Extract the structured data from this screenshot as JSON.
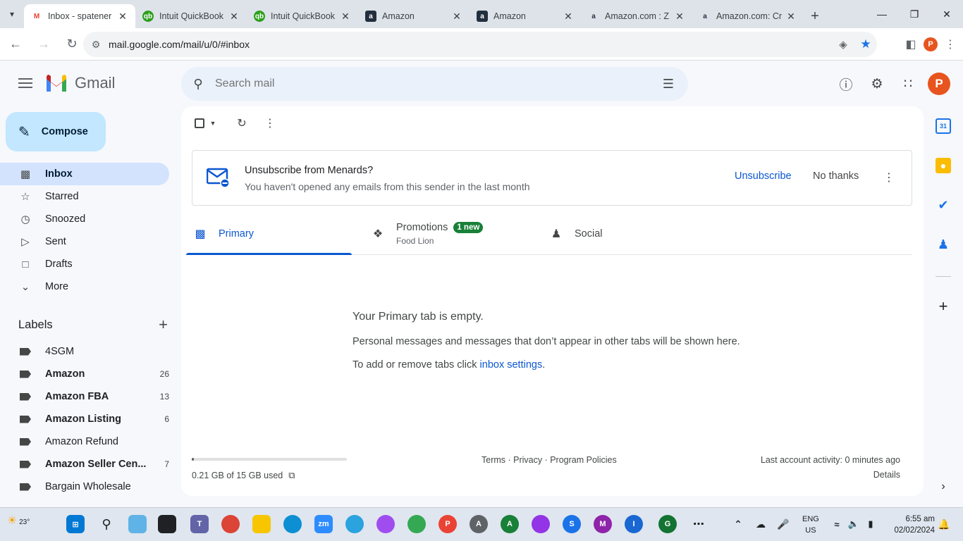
{
  "browser": {
    "tabs": [
      {
        "title": "Inbox - spatener",
        "favicon": "gmail-icon",
        "active": true
      },
      {
        "title": "Intuit QuickBook",
        "favicon": "quickbooks-icon",
        "active": false
      },
      {
        "title": "Intuit QuickBook",
        "favicon": "quickbooks-icon",
        "active": false
      },
      {
        "title": "Amazon",
        "favicon": "amazon-icon",
        "active": false
      },
      {
        "title": "Amazon",
        "favicon": "amazon-icon",
        "active": false
      },
      {
        "title": "Amazon.com : Z",
        "favicon": "amazon-icon",
        "active": false
      },
      {
        "title": "Amazon.com: Cr",
        "favicon": "amazon-icon",
        "active": false
      }
    ],
    "url": "mail.google.com/mail/u/0/#inbox",
    "profile_initial": "P"
  },
  "gmail": {
    "logo_text": "Gmail",
    "search_placeholder": "Search mail",
    "avatar_initial": "P",
    "compose_label": "Compose",
    "nav": [
      {
        "label": "Inbox",
        "icon": "inbox-icon",
        "active": true
      },
      {
        "label": "Starred",
        "icon": "star-icon",
        "active": false
      },
      {
        "label": "Snoozed",
        "icon": "clock-icon",
        "active": false
      },
      {
        "label": "Sent",
        "icon": "send-icon",
        "active": false
      },
      {
        "label": "Drafts",
        "icon": "draft-icon",
        "active": false
      },
      {
        "label": "More",
        "icon": "chevron-down-icon",
        "active": false
      }
    ],
    "labels_title": "Labels",
    "labels": [
      {
        "name": "4SGM",
        "count": "",
        "bold": false
      },
      {
        "name": "Amazon",
        "count": "26",
        "bold": true
      },
      {
        "name": "Amazon FBA",
        "count": "13",
        "bold": true
      },
      {
        "name": "Amazon Listing",
        "count": "6",
        "bold": true
      },
      {
        "name": "Amazon Refund",
        "count": "",
        "bold": false
      },
      {
        "name": "Amazon Seller Cen...",
        "count": "7",
        "bold": true
      },
      {
        "name": "Bargain Wholesale",
        "count": "",
        "bold": false
      }
    ],
    "unsubscribe": {
      "title": "Unsubscribe from Menards?",
      "subtitle": "You haven't opened any emails from this sender in the last month",
      "unsubscribe_label": "Unsubscribe",
      "no_thanks_label": "No thanks"
    },
    "tabs": {
      "primary": "Primary",
      "promotions": "Promotions",
      "promotions_badge": "1 new",
      "promotions_sub": "Food Lion",
      "social": "Social"
    },
    "empty": {
      "title": "Your Primary tab is empty.",
      "description": "Personal messages and messages that don’t appear in other tabs will be shown here.",
      "line3_prefix": "To add or remove tabs click ",
      "line3_link": "inbox settings",
      "line3_suffix": "."
    },
    "footer": {
      "storage": "0.21 GB of 15 GB used",
      "storage_fraction": 0.014,
      "links": "Terms · Privacy · Program Policies",
      "activity": "Last account activity: 0 minutes ago",
      "details": "Details"
    }
  },
  "taskbar": {
    "weather": "23°",
    "lang_top": "ENG",
    "lang_bottom": "US",
    "time": "6:55 am",
    "date": "02/02/2024"
  },
  "colors": {
    "accent": "#0b57d0",
    "compose_bg": "#c2e7ff",
    "active_nav_bg": "#d3e3fd",
    "badge_green": "#188038",
    "avatar": "#e8541e"
  }
}
